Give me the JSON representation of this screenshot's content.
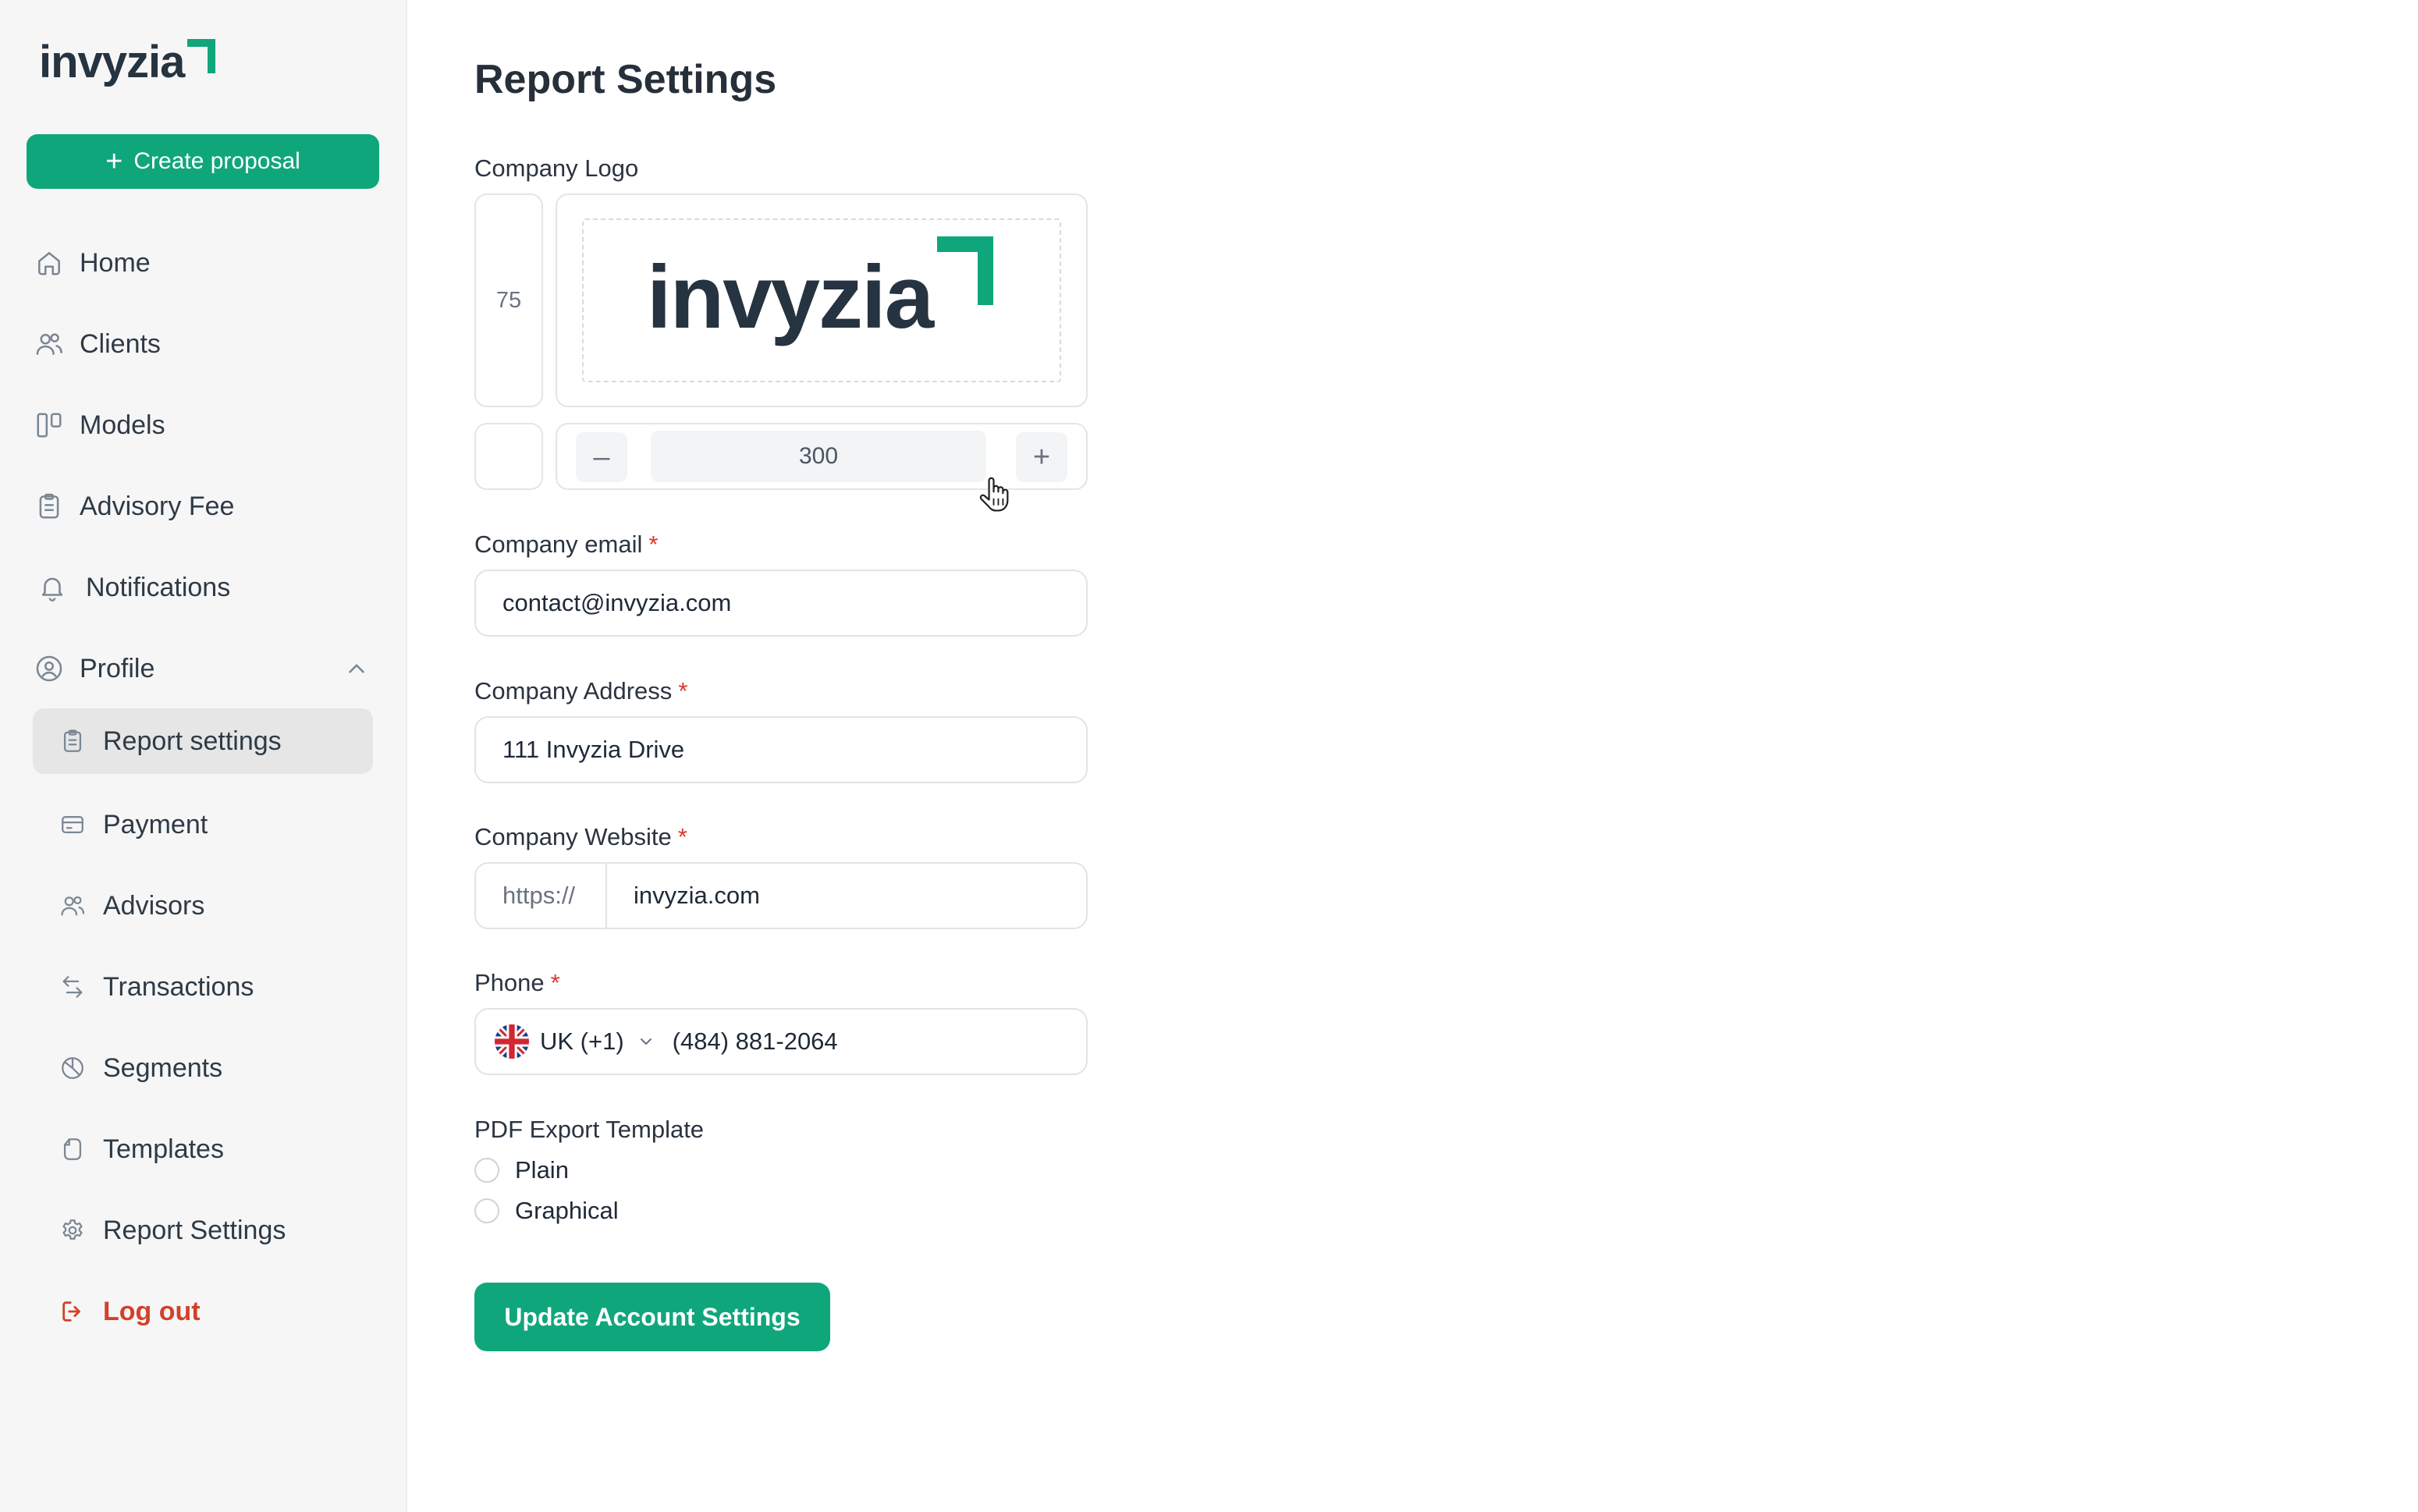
{
  "brand": {
    "name": "invyzia",
    "accent": "#10a67b",
    "dark": "#263340"
  },
  "sidebar": {
    "create_label": "Create proposal",
    "items": [
      {
        "label": "Home",
        "icon": "home-icon"
      },
      {
        "label": "Clients",
        "icon": "users-icon"
      },
      {
        "label": "Models",
        "icon": "columns-icon"
      },
      {
        "label": "Advisory Fee",
        "icon": "clipboard-icon"
      },
      {
        "label": "Notifications",
        "icon": "bell-icon"
      },
      {
        "label": "Profile",
        "icon": "user-circle-icon"
      }
    ],
    "sub_items": [
      {
        "label": "Report settings",
        "icon": "clipboard-icon"
      },
      {
        "label": "Payment",
        "icon": "card-icon"
      },
      {
        "label": "Advisors",
        "icon": "users-icon"
      },
      {
        "label": "Transactions",
        "icon": "arrows-icon"
      },
      {
        "label": "Segments",
        "icon": "pie-icon"
      },
      {
        "label": "Templates",
        "icon": "file-icon"
      },
      {
        "label": "Report Settings",
        "icon": "gear-icon"
      }
    ],
    "logout_label": "Log out"
  },
  "main": {
    "title": "Report Settings",
    "logo_label": "Company Logo",
    "logo_height": "75",
    "logo_width": "300",
    "email": {
      "label": "Company email",
      "value": "contact@invyzia.com"
    },
    "address": {
      "label": "Company Address",
      "value": "111 Invyzia Drive"
    },
    "website": {
      "label": "Company Website",
      "prefix": "https://",
      "value": "invyzia.com"
    },
    "phone": {
      "label": "Phone",
      "country": "UK (+1)",
      "value": "(484) 881-2064"
    },
    "pdf": {
      "label": "PDF Export Template",
      "options": [
        "Plain",
        "Graphical"
      ]
    },
    "submit_label": "Update Account Settings",
    "required_mark": "*"
  }
}
